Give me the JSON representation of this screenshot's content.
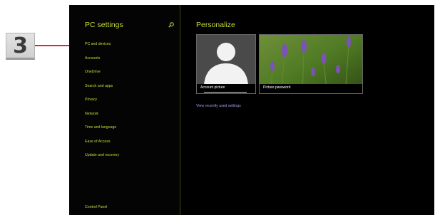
{
  "callout": {
    "number": "3",
    "color": "#e0252f"
  },
  "sidebar": {
    "title": "PC settings",
    "search_icon": "search-icon",
    "items": [
      {
        "label": "PC and devices"
      },
      {
        "label": "Accounts"
      },
      {
        "label": "OneDrive"
      },
      {
        "label": "Search and apps"
      },
      {
        "label": "Privacy"
      },
      {
        "label": "Network"
      },
      {
        "label": "Time and language"
      },
      {
        "label": "Ease of Access"
      },
      {
        "label": "Update and recovery"
      }
    ],
    "footer_link": "Control Panel"
  },
  "main": {
    "heading": "Personalize",
    "tiles": [
      {
        "label": "Account picture",
        "icon": "user-silhouette-icon"
      },
      {
        "label": "Picture password",
        "image": "lavender-photo"
      }
    ],
    "recent_link": "View recently used settings"
  },
  "colors": {
    "accent": "#c9d83a",
    "background": "#000000",
    "link": "#a79be6"
  }
}
